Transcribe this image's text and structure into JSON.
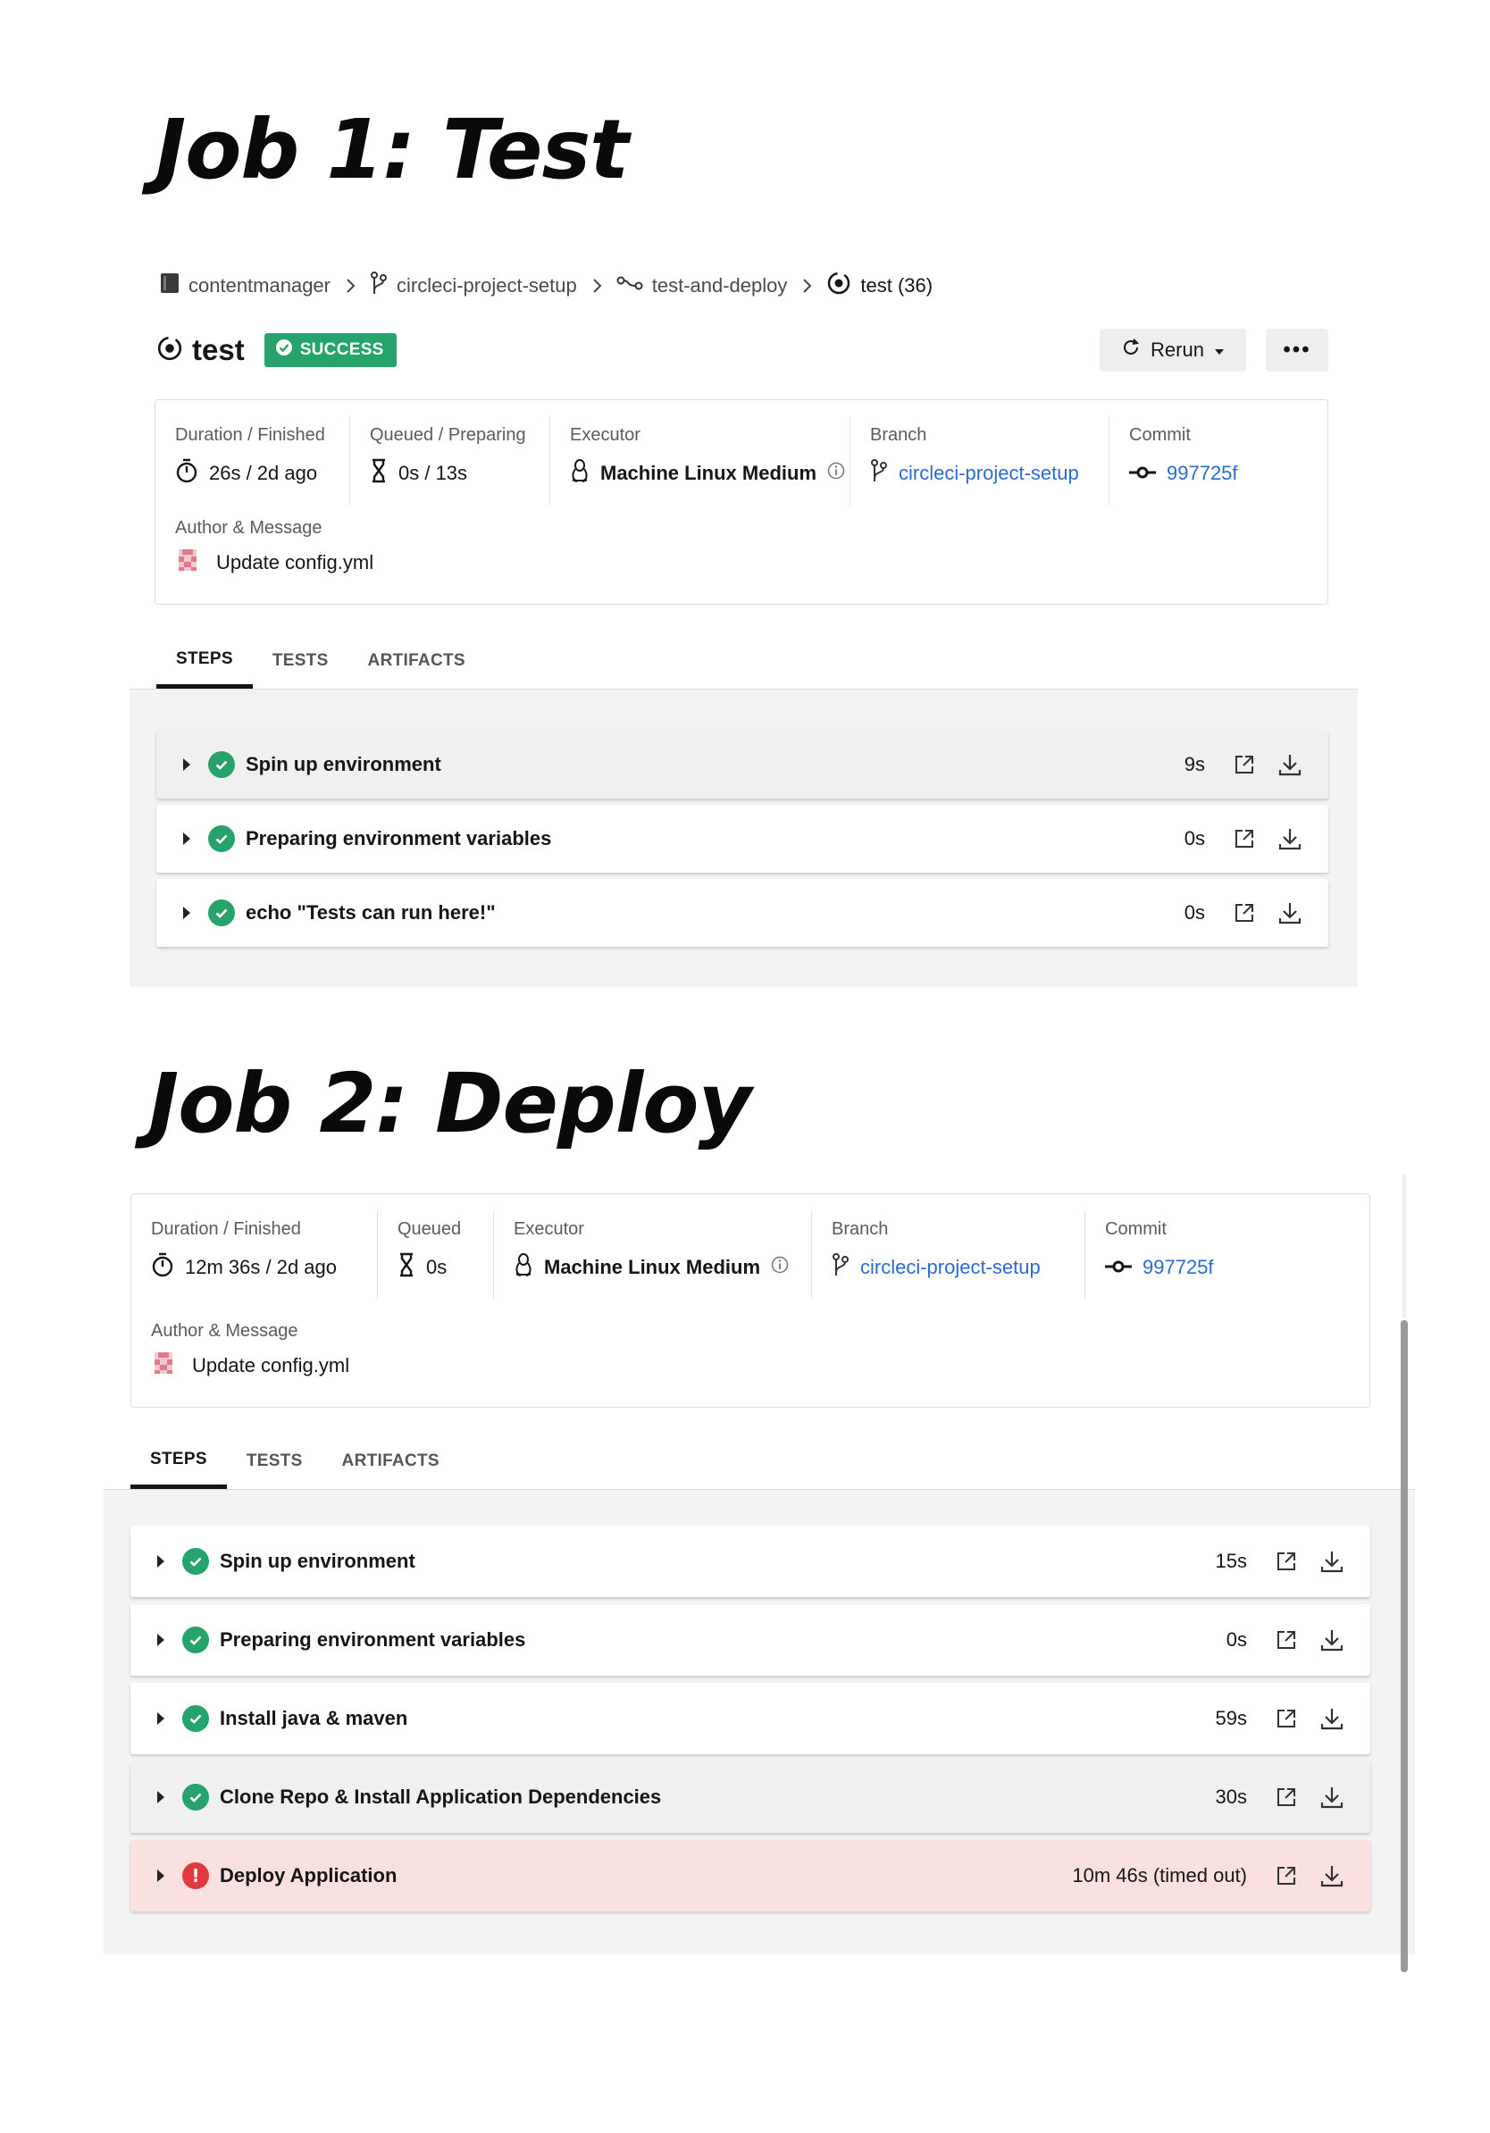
{
  "job1": {
    "heading": "Job 1: Test",
    "breadcrumb": {
      "org": "contentmanager",
      "project": "circleci-project-setup",
      "workflow": "test-and-deploy",
      "job": "test (36)"
    },
    "title": "test",
    "status": "SUCCESS",
    "rerun_label": "Rerun",
    "more_label": "•••",
    "info": {
      "duration_label": "Duration / Finished",
      "duration_value": "26s / 2d ago",
      "queued_label": "Queued / Preparing",
      "queued_value": "0s / 13s",
      "executor_label": "Executor",
      "executor_value": "Machine Linux Medium",
      "branch_label": "Branch",
      "branch_value": "circleci-project-setup",
      "commit_label": "Commit",
      "commit_value": "997725f",
      "author_label": "Author & Message",
      "author_value": "Update config.yml"
    },
    "tabs": [
      "STEPS",
      "TESTS",
      "ARTIFACTS"
    ],
    "steps": [
      {
        "name": "Spin up environment",
        "duration": "9s",
        "status": "success"
      },
      {
        "name": "Preparing environment variables",
        "duration": "0s",
        "status": "success"
      },
      {
        "name": "echo \"Tests can run here!\"",
        "duration": "0s",
        "status": "success"
      }
    ]
  },
  "job2": {
    "heading": "Job 2: Deploy",
    "info": {
      "duration_label": "Duration / Finished",
      "duration_value": "12m 36s / 2d ago",
      "queued_label": "Queued",
      "queued_value": "0s",
      "executor_label": "Executor",
      "executor_value": "Machine Linux Medium",
      "branch_label": "Branch",
      "branch_value": "circleci-project-setup",
      "commit_label": "Commit",
      "commit_value": "997725f",
      "author_label": "Author & Message",
      "author_value": "Update config.yml"
    },
    "tabs": [
      "STEPS",
      "TESTS",
      "ARTIFACTS"
    ],
    "steps": [
      {
        "name": "Spin up environment",
        "duration": "15s",
        "status": "success"
      },
      {
        "name": "Preparing environment variables",
        "duration": "0s",
        "status": "success"
      },
      {
        "name": "Install java & maven",
        "duration": "59s",
        "status": "success"
      },
      {
        "name": "Clone Repo & Install Application Dependencies",
        "duration": "30s",
        "status": "success"
      },
      {
        "name": "Deploy Application",
        "duration": "10m 46s (timed out)",
        "status": "failed"
      }
    ]
  },
  "colors": {
    "success": "#26a36a",
    "failed": "#e0393e",
    "failed_row": "#fbe0e0",
    "link": "#2b6cd0"
  },
  "icons": [
    "repo-icon",
    "branch-icon",
    "workflow-icon",
    "job-icon",
    "stopwatch-icon",
    "hourglass-icon",
    "linux-icon",
    "info-icon",
    "commit-icon",
    "avatar-icon",
    "rerun-icon",
    "caret-down-icon",
    "external-link-icon",
    "download-icon",
    "check-icon",
    "error-icon"
  ]
}
